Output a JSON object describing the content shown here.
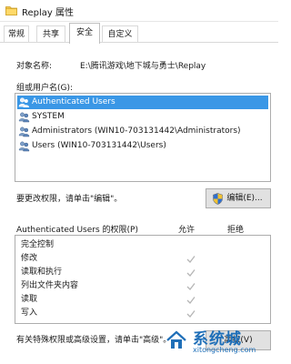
{
  "window": {
    "title": "Replay 属性"
  },
  "tabs": [
    {
      "label": "常规"
    },
    {
      "label": "共享"
    },
    {
      "label": "安全",
      "active": true
    },
    {
      "label": "自定义"
    }
  ],
  "object": {
    "label": "对象名称:",
    "value": "E:\\腾讯游戏\\地下城与勇士\\Replay"
  },
  "groups": {
    "label": "组或用户名(G):",
    "items": [
      {
        "name": "Authenticated Users",
        "selected": true
      },
      {
        "name": "SYSTEM"
      },
      {
        "name": "Administrators (WIN10-703131442\\Administrators)"
      },
      {
        "name": "Users (WIN10-703131442\\Users)"
      }
    ]
  },
  "change_hint": "要更改权限，请单击\"编辑\"。",
  "edit_button": "编辑(E)...",
  "permissions": {
    "header": "Authenticated Users 的权限(P)",
    "allow_label": "允许",
    "deny_label": "拒绝",
    "rows": [
      {
        "name": "完全控制",
        "allow": false,
        "deny": false
      },
      {
        "name": "修改",
        "allow": true,
        "deny": false
      },
      {
        "name": "读取和执行",
        "allow": true,
        "deny": false
      },
      {
        "name": "列出文件夹内容",
        "allow": true,
        "deny": false
      },
      {
        "name": "读取",
        "allow": true,
        "deny": false
      },
      {
        "name": "写入",
        "allow": true,
        "deny": false
      }
    ]
  },
  "special_hint": "有关特殊权限或高级设置，请单击\"高级\"。",
  "advanced_button": "高级(V)",
  "watermark": {
    "title": "系统城",
    "url": "xitongcheng.com"
  },
  "colors": {
    "selection": "#3a97e6",
    "check": "#b5b5b5",
    "watermark": "#1f6fb8"
  }
}
